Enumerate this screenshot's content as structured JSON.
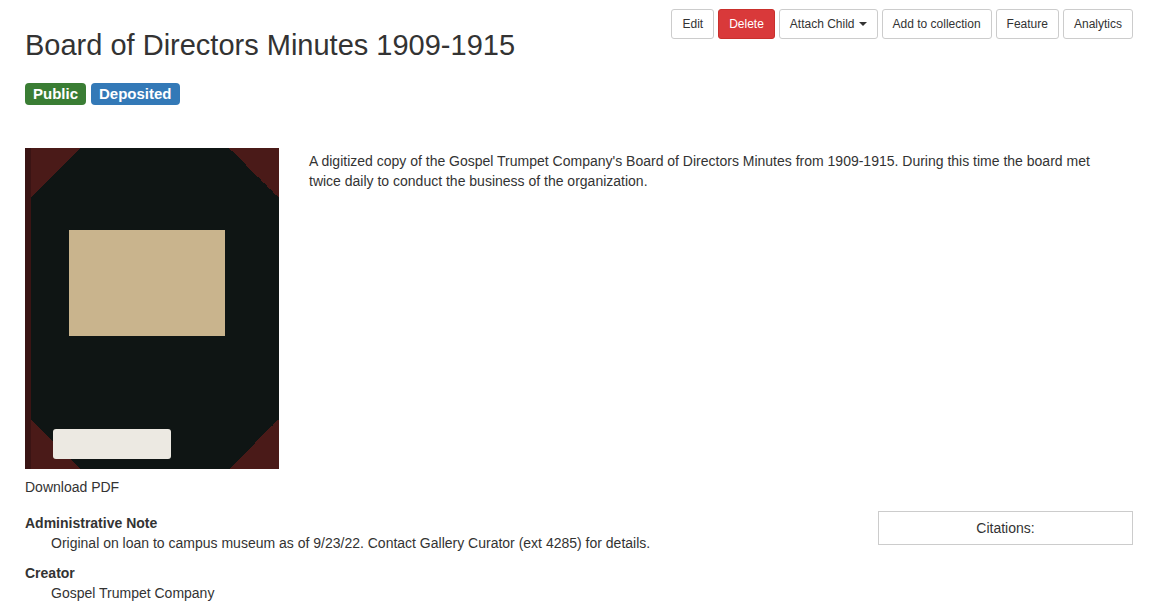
{
  "page": {
    "title": "Board of Directors Minutes 1909-1915"
  },
  "toolbar": {
    "buttons": [
      {
        "label": "Edit",
        "kind": "default",
        "dropdown": false
      },
      {
        "label": "Delete",
        "kind": "danger",
        "dropdown": false
      },
      {
        "label": "Attach Child",
        "kind": "default",
        "dropdown": true
      },
      {
        "label": "Add to collection",
        "kind": "default",
        "dropdown": false
      },
      {
        "label": "Feature",
        "kind": "default",
        "dropdown": false
      },
      {
        "label": "Analytics",
        "kind": "default",
        "dropdown": false
      }
    ]
  },
  "badges": [
    {
      "label": "Public",
      "color": "#3a7d34"
    },
    {
      "label": "Deposited",
      "color": "#3379b7"
    }
  ],
  "description": "A digitized copy of the Gospel Trumpet Company's Board of Directors Minutes from 1909-1915. During this time the board met twice daily to conduct the business of the organization.",
  "download": {
    "label": "Download PDF"
  },
  "fields": [
    {
      "label": "Administrative Note",
      "value": "Original on loan to campus museum as of 9/23/22. Contact Gallery Curator (ext 4285) for details."
    },
    {
      "label": "Creator",
      "value": "Gospel Trumpet Company"
    }
  ],
  "citations": {
    "label": "Citations:"
  }
}
